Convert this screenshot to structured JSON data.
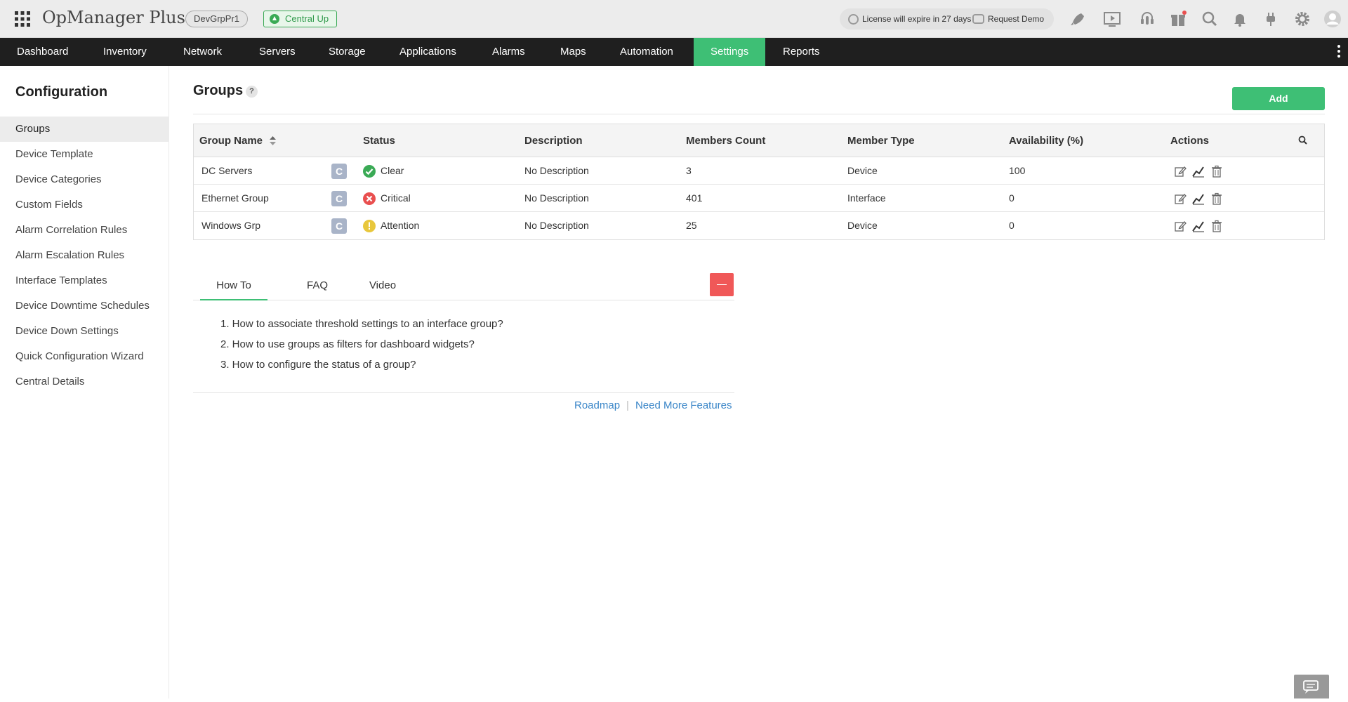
{
  "app": {
    "title": "OpManager Plus",
    "group_badge": "DevGrpPr1",
    "central_status": "Central Up",
    "license_text": "License will expire in 27 days",
    "request_demo": "Request Demo"
  },
  "top_icons": [
    "rocket-icon",
    "video-tutorial-icon",
    "support-headset-icon",
    "gift-icon",
    "search-icon",
    "bell-icon",
    "plug-icon",
    "gear-icon",
    "user-avatar-icon"
  ],
  "nav": {
    "items": [
      {
        "label": "Dashboard"
      },
      {
        "label": "Inventory"
      },
      {
        "label": "Network"
      },
      {
        "label": "Servers"
      },
      {
        "label": "Storage"
      },
      {
        "label": "Applications"
      },
      {
        "label": "Alarms"
      },
      {
        "label": "Maps"
      },
      {
        "label": "Automation"
      },
      {
        "label": "Settings"
      },
      {
        "label": "Reports"
      }
    ],
    "active": "Settings"
  },
  "sidebar": {
    "title": "Configuration",
    "items": [
      {
        "label": "Groups"
      },
      {
        "label": "Device Template"
      },
      {
        "label": "Device Categories"
      },
      {
        "label": "Custom Fields"
      },
      {
        "label": "Alarm Correlation Rules"
      },
      {
        "label": "Alarm Escalation Rules"
      },
      {
        "label": "Interface Templates"
      },
      {
        "label": "Device Downtime Schedules"
      },
      {
        "label": "Device Down Settings"
      },
      {
        "label": "Quick Configuration Wizard"
      },
      {
        "label": "Central Details"
      }
    ],
    "active": "Groups"
  },
  "page": {
    "title": "Groups",
    "help": "?",
    "add_label": "Add"
  },
  "table": {
    "columns": [
      "Group Name",
      "Status",
      "Description",
      "Members Count",
      "Member Type",
      "Availability (%)",
      "Actions"
    ],
    "rows": [
      {
        "name": "DC Servers",
        "badge": "C",
        "status": "Clear",
        "description": "No Description",
        "members": "3",
        "type": "Device",
        "availability": "100"
      },
      {
        "name": "Ethernet Group",
        "badge": "C",
        "status": "Critical",
        "description": "No Description",
        "members": "401",
        "type": "Interface",
        "availability": "0"
      },
      {
        "name": "Windows Grp",
        "badge": "C",
        "status": "Attention",
        "description": "No Description",
        "members": "25",
        "type": "Device",
        "availability": "0"
      }
    ]
  },
  "colors": {
    "accent": "#3ebf75",
    "nav_bg": "#1f1f1f",
    "clear": "#3aaa55",
    "critical": "#e94f4f",
    "attention": "#e8c73c",
    "link": "#3a86c8"
  },
  "help_panel": {
    "tabs": [
      "How To",
      "FAQ",
      "Video"
    ],
    "active_tab": "How To",
    "items": [
      "1. How to associate threshold settings to an interface group?",
      "2. How to use groups as filters for dashboard widgets?",
      "3. How to configure the status of a group?"
    ],
    "footer": {
      "roadmap": "Roadmap",
      "more": "Need More Features"
    }
  }
}
